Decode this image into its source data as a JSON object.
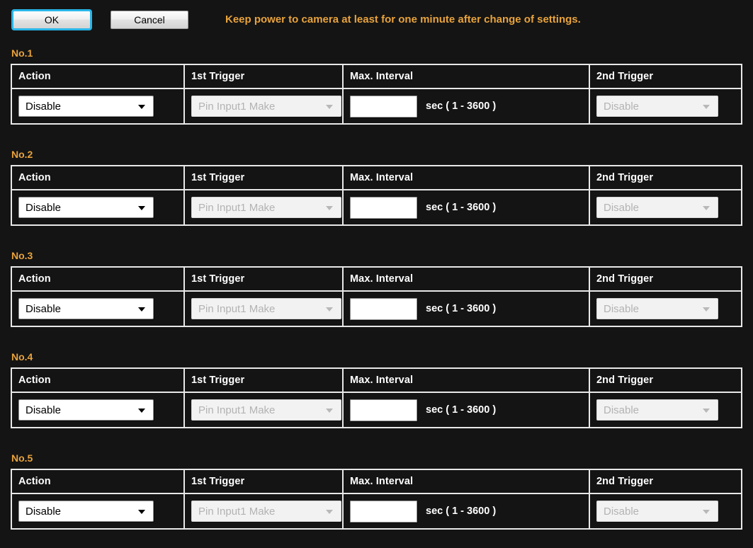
{
  "toolbar": {
    "ok_label": "OK",
    "cancel_label": "Cancel",
    "notice": "Keep power to camera at least for one minute after change of settings."
  },
  "columns": {
    "action": "Action",
    "trigger1": "1st Trigger",
    "interval": "Max. Interval",
    "trigger2": "2nd Trigger"
  },
  "units": {
    "interval_hint": "sec ( 1 - 3600 )"
  },
  "colors": {
    "accent": "#e8a33d",
    "focus_ring": "#29b6e8",
    "background": "#141414",
    "border": "#e8e8e8"
  },
  "sections": [
    {
      "label": "No.1",
      "action_value": "Disable",
      "trigger1_value": "Pin Input1 Make",
      "interval_value": "",
      "interval_hint": "sec ( 1 - 3600 )",
      "trigger2_value": "Disable"
    },
    {
      "label": "No.2",
      "action_value": "Disable",
      "trigger1_value": "Pin Input1 Make",
      "interval_value": "",
      "interval_hint": "sec ( 1 - 3600 )",
      "trigger2_value": "Disable"
    },
    {
      "label": "No.3",
      "action_value": "Disable",
      "trigger1_value": "Pin Input1 Make",
      "interval_value": "",
      "interval_hint": "sec ( 1 - 3600 )",
      "trigger2_value": "Disable"
    },
    {
      "label": "No.4",
      "action_value": "Disable",
      "trigger1_value": "Pin Input1 Make",
      "interval_value": "",
      "interval_hint": "sec ( 1 - 3600 )",
      "trigger2_value": "Disable"
    },
    {
      "label": "No.5",
      "action_value": "Disable",
      "trigger1_value": "Pin Input1 Make",
      "interval_value": "",
      "interval_hint": "sec ( 1 - 3600 )",
      "trigger2_value": "Disable"
    }
  ]
}
